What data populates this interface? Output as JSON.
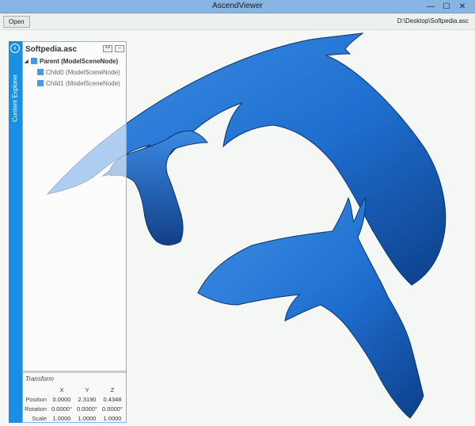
{
  "window": {
    "title": "AscendViewer",
    "minimize": "—",
    "maximize": "☐",
    "close": "✕"
  },
  "toolbar": {
    "open_label": "Open",
    "file_path": "D:\\Desktop\\Softpedia.asc"
  },
  "sidebar": {
    "tab_label": "Content Explorer",
    "back_icon": "back-arrow-icon"
  },
  "explorer": {
    "title": "Softpedia.asc",
    "expand_label": "++",
    "collapse_label": "--",
    "tree": [
      {
        "label": "Parent (ModelSceneNode)"
      },
      {
        "label": "Child0 (ModelSceneNode)"
      },
      {
        "label": "Child1 (ModelSceneNode)"
      }
    ]
  },
  "transform": {
    "title": "Transform",
    "headers": [
      "X",
      "Y",
      "Z"
    ],
    "rows": [
      {
        "label": "Position",
        "x": "0.0000",
        "y": "2.3190",
        "z": "0.4348"
      },
      {
        "label": "Rotation",
        "x": "0.0000°",
        "y": "0.0000°",
        "z": "0.0000°"
      },
      {
        "label": "Scale",
        "x": "1.0000",
        "y": "1.0000",
        "z": "1.0000"
      }
    ]
  },
  "colors": {
    "model": "#1f6fd0",
    "accent": "#1a8ee0",
    "titlebar": "#86b5e4"
  }
}
